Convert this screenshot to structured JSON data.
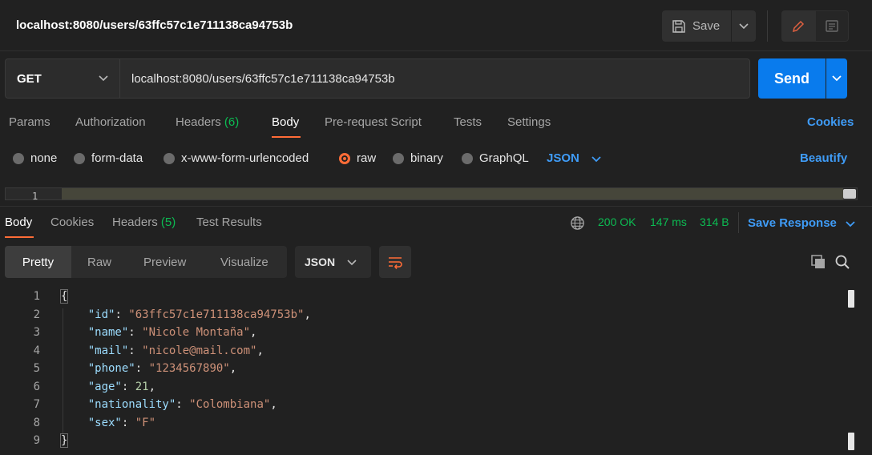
{
  "header": {
    "title": "localhost:8080/users/63ffc57c1e711138ca94753b",
    "save_label": "Save"
  },
  "request": {
    "method": "GET",
    "url": "localhost:8080/users/63ffc57c1e711138ca94753b",
    "send_label": "Send"
  },
  "request_tabs": {
    "params": "Params",
    "authorization": "Authorization",
    "headers": "Headers",
    "headers_count": "(6)",
    "body": "Body",
    "prerequest": "Pre-request Script",
    "tests": "Tests",
    "settings": "Settings",
    "cookies": "Cookies"
  },
  "body_types": {
    "none": "none",
    "form_data": "form-data",
    "urlencoded": "x-www-form-urlencoded",
    "raw": "raw",
    "binary": "binary",
    "graphql": "GraphQL",
    "format": "JSON",
    "beautify": "Beautify",
    "selected": "raw"
  },
  "editor": {
    "line_number": "1"
  },
  "response_tabs": {
    "body": "Body",
    "cookies": "Cookies",
    "headers": "Headers",
    "headers_count": "(5)",
    "test_results": "Test Results"
  },
  "response_status": {
    "status": "200 OK",
    "time": "147 ms",
    "size": "314 B",
    "save_response": "Save Response"
  },
  "view_options": {
    "pretty": "Pretty",
    "raw": "Raw",
    "preview": "Preview",
    "visualize": "Visualize",
    "format": "JSON"
  },
  "response_body": {
    "line_numbers": [
      "1",
      "2",
      "3",
      "4",
      "5",
      "6",
      "7",
      "8",
      "9"
    ],
    "open_brace": "{",
    "close_brace": "}",
    "fields": [
      {
        "key": "\"id\"",
        "value": "\"63ffc57c1e711138ca94753b\"",
        "kind": "string",
        "comma": ","
      },
      {
        "key": "\"name\"",
        "value": "\"Nicole Montaña\"",
        "kind": "string",
        "comma": ","
      },
      {
        "key": "\"mail\"",
        "value": "\"nicole@mail.com\"",
        "kind": "string",
        "comma": ","
      },
      {
        "key": "\"phone\"",
        "value": "\"1234567890\"",
        "kind": "string",
        "comma": ","
      },
      {
        "key": "\"age\"",
        "value": "21",
        "kind": "number",
        "comma": ","
      },
      {
        "key": "\"nationality\"",
        "value": "\"Colombiana\"",
        "kind": "string",
        "comma": ","
      },
      {
        "key": "\"sex\"",
        "value": "\"F\"",
        "kind": "string",
        "comma": ""
      }
    ]
  },
  "colors": {
    "accent": "#ff6c37",
    "send": "#097bed",
    "link": "#3f9cf7",
    "status_ok": "#0cbb52",
    "json_key": "#9cdcfe",
    "json_string": "#ce9178",
    "json_number": "#b5cea8"
  }
}
